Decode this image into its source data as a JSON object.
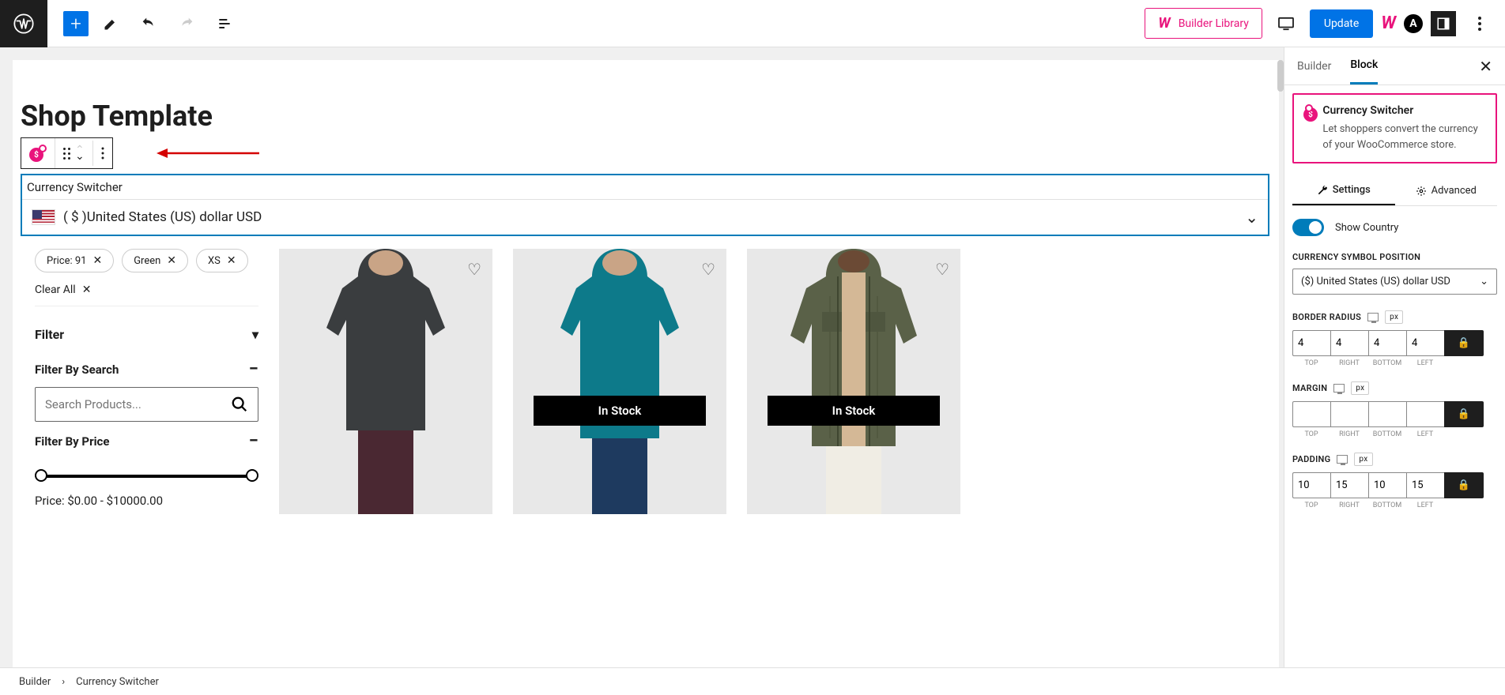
{
  "topbar": {
    "builder_library": "Builder Library",
    "update": "Update"
  },
  "page_title": "Shop Template",
  "currency_block": {
    "title": "Currency Switcher",
    "value": "( $ )United States (US) dollar USD"
  },
  "filters": {
    "chips": [
      "Price: 91",
      "Green",
      "XS"
    ],
    "clear_all": "Clear All",
    "filter_heading": "Filter",
    "by_search": "Filter By Search",
    "search_placeholder": "Search Products...",
    "by_price": "Filter By Price",
    "price_text": "Price: $0.00 - $10000.00"
  },
  "products": [
    {
      "in_stock": ""
    },
    {
      "in_stock": "In Stock"
    },
    {
      "in_stock": "In Stock"
    }
  ],
  "sidebar": {
    "tabs": {
      "builder": "Builder",
      "block": "Block"
    },
    "info": {
      "title": "Currency Switcher",
      "desc": "Let shoppers convert the currency of your WooCommerce store."
    },
    "sub_tabs": {
      "settings": "Settings",
      "advanced": "Advanced"
    },
    "show_country": "Show Country",
    "symbol_position_label": "CURRENCY SYMBOL POSITION",
    "symbol_position_value": "($) United States (US) dollar USD",
    "border_radius_label": "BORDER RADIUS",
    "border_radius": {
      "top": "4",
      "right": "4",
      "bottom": "4",
      "left": "4"
    },
    "margin_label": "MARGIN",
    "margin": {
      "top": "",
      "right": "",
      "bottom": "",
      "left": ""
    },
    "padding_label": "PADDING",
    "padding": {
      "top": "10",
      "right": "15",
      "bottom": "10",
      "left": "15"
    },
    "sides": {
      "top": "TOP",
      "right": "RIGHT",
      "bottom": "BOTTOM",
      "left": "LEFT"
    },
    "px": "px"
  },
  "breadcrumb": {
    "root": "Builder",
    "current": "Currency Switcher"
  }
}
